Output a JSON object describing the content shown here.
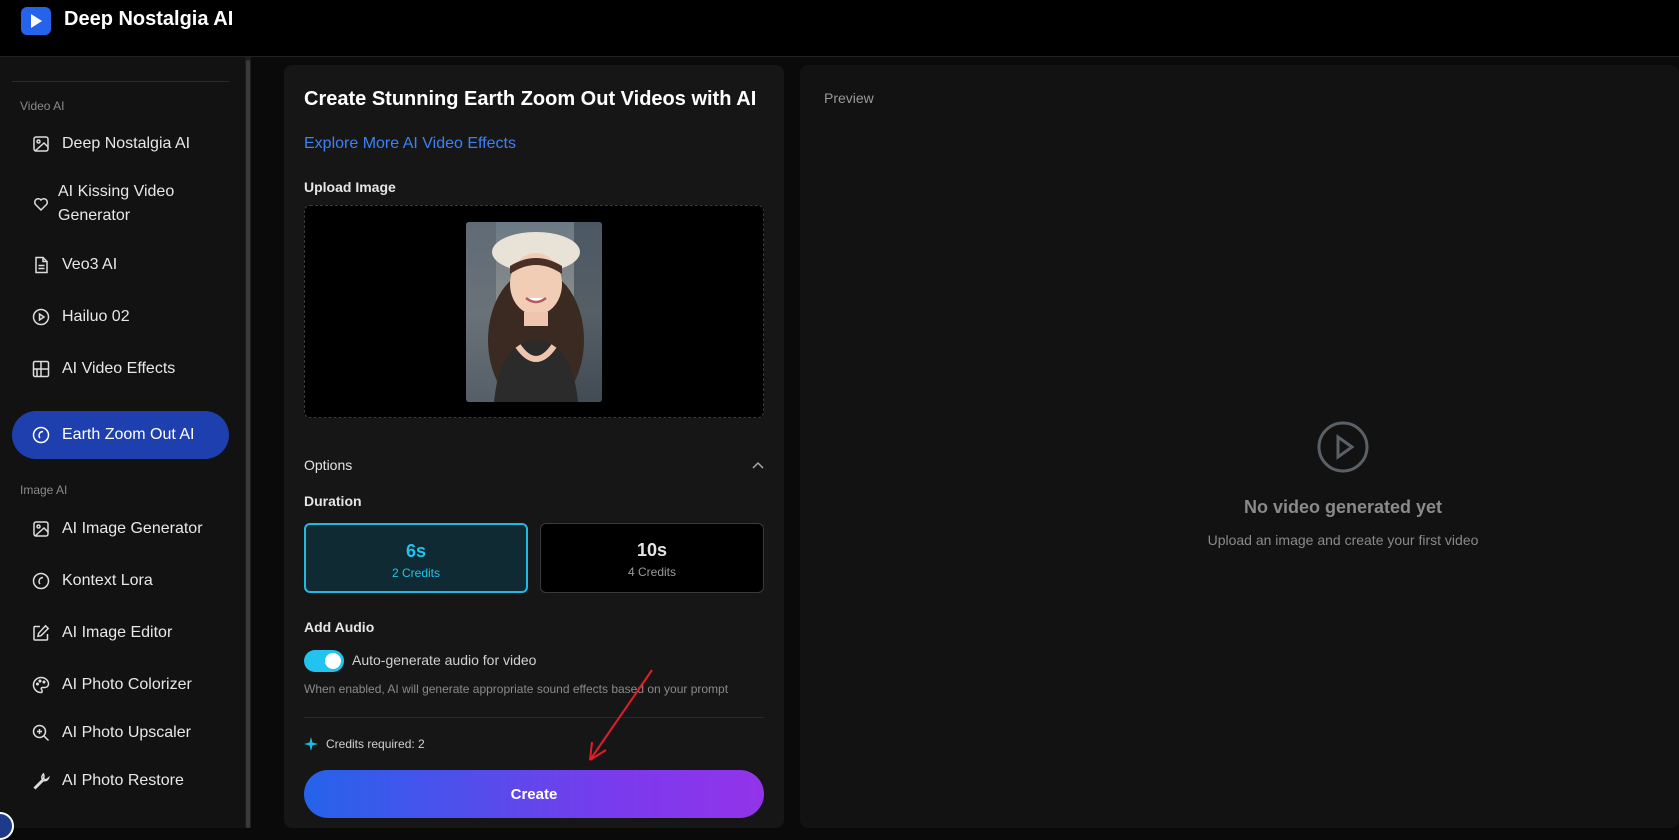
{
  "app": {
    "title": "Deep Nostalgia AI"
  },
  "sidebar": {
    "sections": [
      {
        "label": "Video AI"
      },
      {
        "label": "Image AI"
      }
    ],
    "items": [
      {
        "label": "Deep Nostalgia AI",
        "icon": "image-icon"
      },
      {
        "label": "AI Kissing Video Generator",
        "icon": "heart-icon"
      },
      {
        "label": "Veo3 AI",
        "icon": "document-icon"
      },
      {
        "label": "Hailuo 02",
        "icon": "play-circle-icon"
      },
      {
        "label": "AI Video Effects",
        "icon": "layout-grid-icon"
      },
      {
        "label": "Earth Zoom Out AI",
        "icon": "circle-icon",
        "active": true
      },
      {
        "label": "AI Image Generator",
        "icon": "image-icon"
      },
      {
        "label": "Kontext Lora",
        "icon": "circle-icon"
      },
      {
        "label": "AI Image Editor",
        "icon": "edit-icon"
      },
      {
        "label": "AI Photo Colorizer",
        "icon": "palette-icon"
      },
      {
        "label": "AI Photo Upscaler",
        "icon": "zoom-in-icon"
      },
      {
        "label": "AI Photo Restore",
        "icon": "wrench-icon"
      }
    ]
  },
  "main": {
    "title": "Create Stunning Earth Zoom Out Videos with AI",
    "explore_link": "Explore More AI Video Effects",
    "upload_label": "Upload Image",
    "options_label": "Options",
    "duration_label": "Duration",
    "durations": [
      {
        "value": "6s",
        "credits": "2 Credits",
        "selected": true
      },
      {
        "value": "10s",
        "credits": "4 Credits",
        "selected": false
      }
    ],
    "add_audio_label": "Add Audio",
    "audio_toggle_label": "Auto-generate audio for video",
    "audio_toggle_on": true,
    "audio_hint": "When enabled, AI will generate appropriate sound effects based on your prompt",
    "credits_required": "Credits required: 2",
    "create_button": "Create"
  },
  "preview": {
    "label": "Preview",
    "empty_title": "No video generated yet",
    "empty_subtitle": "Upload an image and create your first video"
  },
  "colors": {
    "accent": "#2563eb",
    "active_nav": "#1e40af",
    "cyan": "#22c3ee",
    "link": "#3b82f6",
    "annotation_arrow": "#e11d2a"
  }
}
